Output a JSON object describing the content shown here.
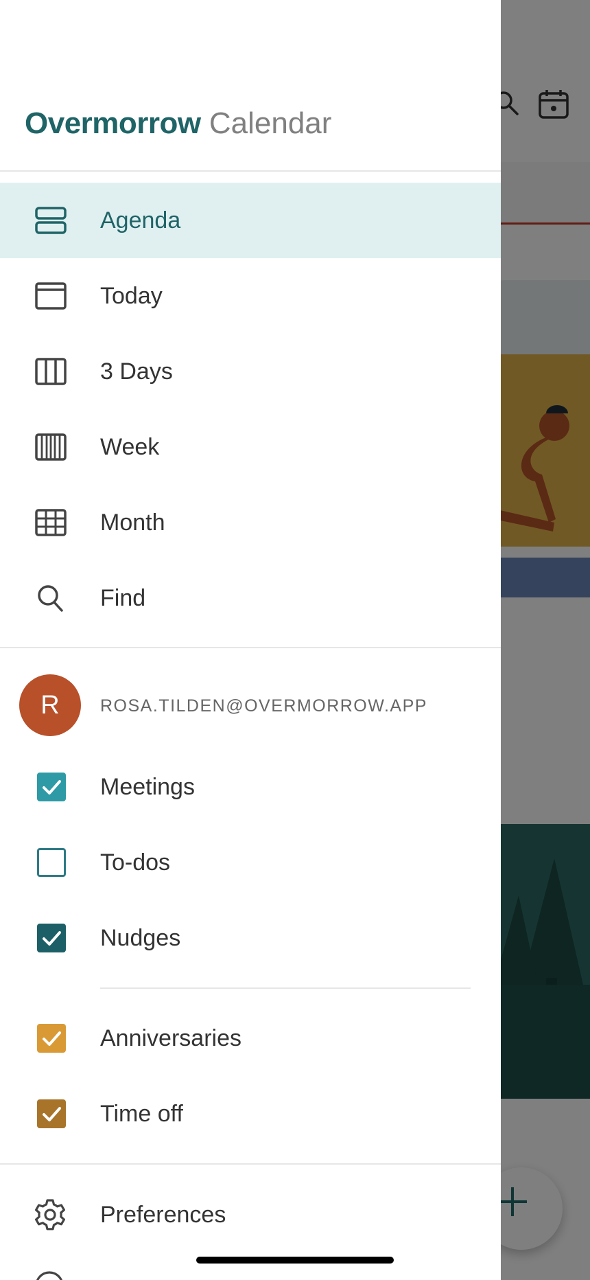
{
  "app": {
    "brand": "Overmorrow",
    "product": "Calendar"
  },
  "nav": {
    "items": [
      {
        "label": "Agenda",
        "icon": "agenda-icon",
        "active": true
      },
      {
        "label": "Today",
        "icon": "day-view-icon",
        "active": false
      },
      {
        "label": "3 Days",
        "icon": "three-day-view-icon",
        "active": false
      },
      {
        "label": "Week",
        "icon": "week-view-icon",
        "active": false
      },
      {
        "label": "Month",
        "icon": "month-grid-icon",
        "active": false
      },
      {
        "label": "Find",
        "icon": "search-icon",
        "active": false
      }
    ]
  },
  "account": {
    "avatar_initial": "R",
    "email": "ROSA.TILDEN@OVERMORROW.APP",
    "avatar_color": "#b8502a"
  },
  "calendars": {
    "primary": [
      {
        "label": "Meetings",
        "checked": true,
        "color": "#2e9aa6"
      },
      {
        "label": "To-dos",
        "checked": false,
        "color": "#2e7a86"
      },
      {
        "label": "Nudges",
        "checked": true,
        "color": "#1d5f66"
      }
    ],
    "other": [
      {
        "label": "Anniversaries",
        "checked": true,
        "color": "#d99a36"
      },
      {
        "label": "Time off",
        "checked": true,
        "color": "#a8742a"
      }
    ]
  },
  "footer": {
    "preferences_label": "Preferences"
  },
  "colors": {
    "accent": "#1f6467",
    "active_bg": "#e0f0f1"
  }
}
